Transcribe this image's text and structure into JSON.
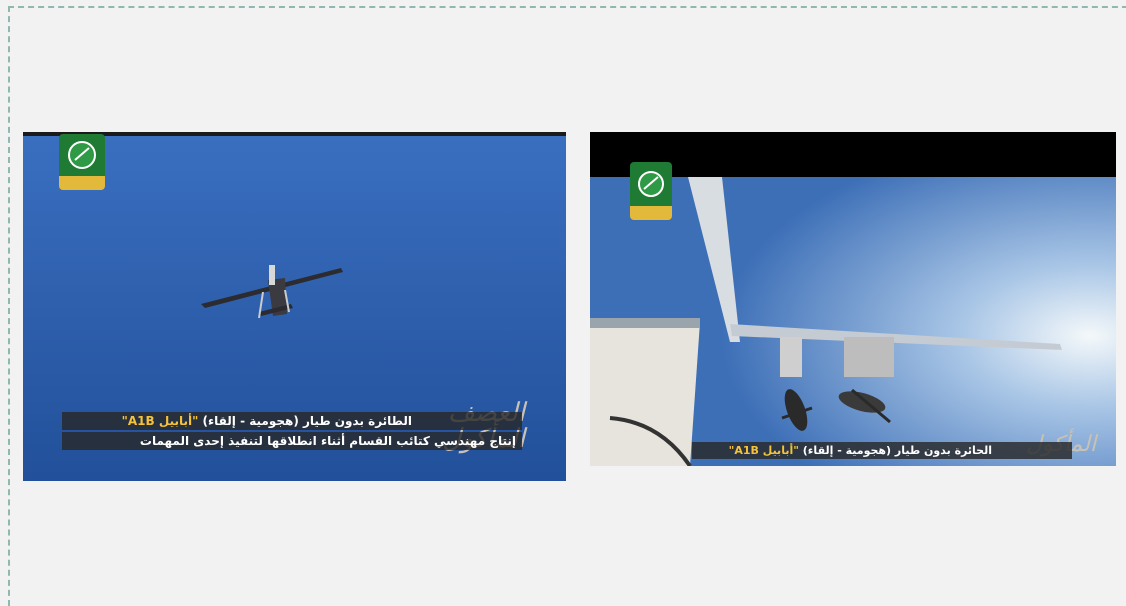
{
  "panels": [
    {
      "id": "left",
      "caption": {
        "line1_prefix": "الطائرة بدون طيار (هجومية - إلقاء) ",
        "line1_name": "\"أبابيل A1B\"",
        "line2": "إنتاج مهندسي كتائب القسام أثناء انطلاقها لتنفيذ إحدى المهمات"
      },
      "calligraphy": "العصف المأكول",
      "colors": {
        "sky_top": "#3568b8",
        "sky_bottom": "#234f97",
        "caption_bg": "#2e2e2e",
        "highlight": "#f5c23a"
      }
    },
    {
      "id": "right",
      "caption": {
        "line1_prefix": "الحائرة بدون طيار (هجومية - إلقاء) ",
        "line1_name": "\"أبابيل A1B\""
      },
      "calligraphy": "المأكول",
      "colors": {
        "sky_top": "#4a7fc6",
        "sky_glow": "#eef4f8",
        "letterbox": "#000000"
      }
    }
  ],
  "icons": [
    "qassam-logo-icon",
    "drone-icon",
    "bomb-icon"
  ]
}
